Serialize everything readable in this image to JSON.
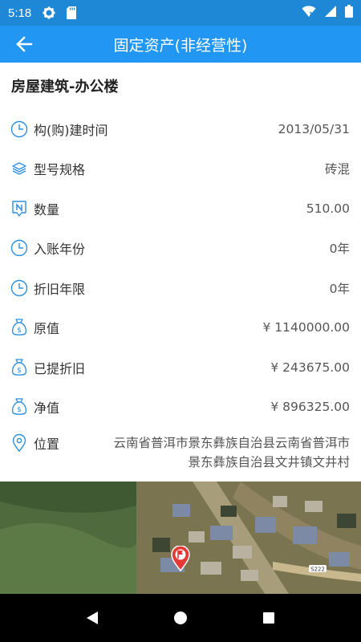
{
  "status_bar": {
    "time": "5:18"
  },
  "app_bar": {
    "title": "固定资产(非经营性)"
  },
  "asset": {
    "name": "房屋建筑-办公楼",
    "fields": [
      {
        "icon": "clock-icon",
        "label": "构(购)建时间",
        "value": "2013/05/31"
      },
      {
        "icon": "layers-icon",
        "label": "型号规格",
        "value": "砖混"
      },
      {
        "icon": "quantity-icon",
        "label": "数量",
        "value": "510.00"
      },
      {
        "icon": "clock-icon",
        "label": "入账年份",
        "value": "0年"
      },
      {
        "icon": "clock-icon",
        "label": "折旧年限",
        "value": "0年"
      },
      {
        "icon": "money-bag-icon",
        "label": "原值",
        "value": "¥ 1140000.00"
      },
      {
        "icon": "money-bag-icon",
        "label": "已提折旧",
        "value": "¥ 243675.00"
      },
      {
        "icon": "money-bag-icon",
        "label": "净值",
        "value": "¥ 896325.00"
      }
    ],
    "location": {
      "icon": "location-pin-icon",
      "label": "位置",
      "value": "云南省普洱市景东彝族自治县云南省普洱市景东彝族自治县文井镇文井村"
    }
  },
  "map": {
    "road_label": "S222"
  },
  "colors": {
    "status_bar": "#1e88d6",
    "app_bar": "#2196f3",
    "icon_blue": "#2b8fe0",
    "marker_red": "#e53935"
  }
}
